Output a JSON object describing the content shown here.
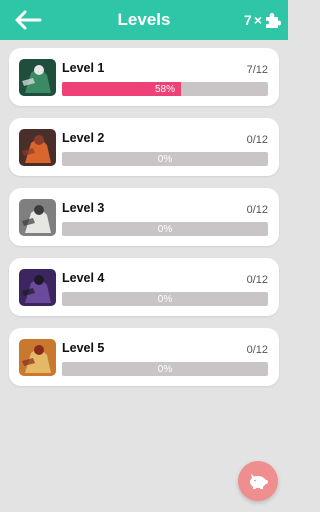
{
  "header": {
    "title": "Levels",
    "pieces_count": "7",
    "pieces_times": "×",
    "back_icon": "arrow-left-icon",
    "pieces_icon": "puzzle-piece-icon",
    "bar_color": "#2ec6a6"
  },
  "levels": [
    {
      "title": "Level 1",
      "count": "7/12",
      "progress": 0.58,
      "progress_text": "58%",
      "thumb_colors": [
        "#1f4e3d",
        "#3b8a64",
        "#e6e6e6"
      ]
    },
    {
      "title": "Level 2",
      "count": "0/12",
      "progress": 0,
      "progress_text": "0%",
      "thumb_colors": [
        "#4a2e2a",
        "#d9662c",
        "#8c3c2a"
      ]
    },
    {
      "title": "Level 3",
      "count": "0/12",
      "progress": 0,
      "progress_text": "0%",
      "thumb_colors": [
        "#7f7f80",
        "#e8e6e3",
        "#3b3b3c"
      ]
    },
    {
      "title": "Level 4",
      "count": "0/12",
      "progress": 0,
      "progress_text": "0%",
      "thumb_colors": [
        "#3d2660",
        "#6a4a9c",
        "#1e1a26"
      ]
    },
    {
      "title": "Level 5",
      "count": "0/12",
      "progress": 0,
      "progress_text": "0%",
      "thumb_colors": [
        "#c8792f",
        "#e3b866",
        "#8a2a1f"
      ]
    }
  ],
  "fab": {
    "icon": "piggy-bank-icon",
    "color": "#ef8e8f"
  },
  "colors": {
    "progress_fill": "#ee4178",
    "progress_track": "#c9c5c6",
    "background": "#e3e3e3"
  }
}
